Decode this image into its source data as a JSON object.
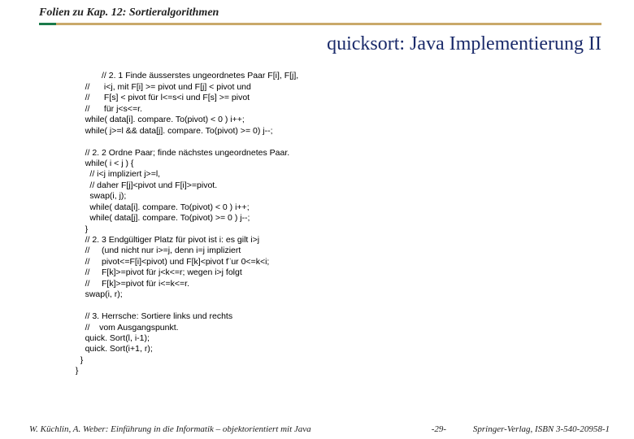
{
  "header": "Folien zu Kap. 12: Sortieralgorithmen",
  "title": "quicksort: Java Implementierung II",
  "code": {
    "l01": "            // 2. 1 Finde äusserstes ungeordnetes Paar F[i], F[j],",
    "l02": "     //      i<j, mit F[i] >= pivot und F[j] < pivot und",
    "l03": "     //      F[s] < pivot für l<=s<i und F[s] >= pivot",
    "l04": "     //      für j<s<=r.",
    "l05": "     while( data[i]. compare. To(pivot) < 0 ) i++;",
    "l06": "     while( j>=l && data[j]. compare. To(pivot) >= 0) j--;",
    "l07": "",
    "l08": "     // 2. 2 Ordne Paar; finde nächstes ungeordnetes Paar.",
    "l09": "     while( i < j ) {",
    "l10": "       // i<j impliziert j>=l,",
    "l11": "       // daher F[j]<pivot und F[i]>=pivot.",
    "l12": "       swap(i, j);",
    "l13": "       while( data[i]. compare. To(pivot) < 0 ) i++;",
    "l14": "       while( data[j]. compare. To(pivot) >= 0 ) j--;",
    "l15": "     }",
    "l16": "     // 2. 3 Endgültiger Platz für pivot ist i: es gilt i>j",
    "l17": "     //     (und nicht nur i>=j, denn i=j impliziert",
    "l18": "     //     pivot<=F[i]<pivot) und F[k]<pivot f¨ur 0<=k<i;",
    "l19": "     //     F[k]>=pivot für j<k<=r; wegen i>j folgt",
    "l20": "     //     F[k]>=pivot für i<=k<=r.",
    "l21": "     swap(i, r);",
    "l22": "",
    "l23": "     // 3. Herrsche: Sortiere links und rechts",
    "l24": "     //    vom Ausgangspunkt.",
    "l25": "     quick. Sort(l, i-1);",
    "l26": "     quick. Sort(i+1, r);",
    "l27": "   }",
    "l28": " }"
  },
  "footer": {
    "left": "W. Küchlin, A. Weber: Einführung in die Informatik – objektorientiert mit Java",
    "page": "-29-",
    "right": "Springer-Verlag, ISBN 3-540-20958-1"
  }
}
